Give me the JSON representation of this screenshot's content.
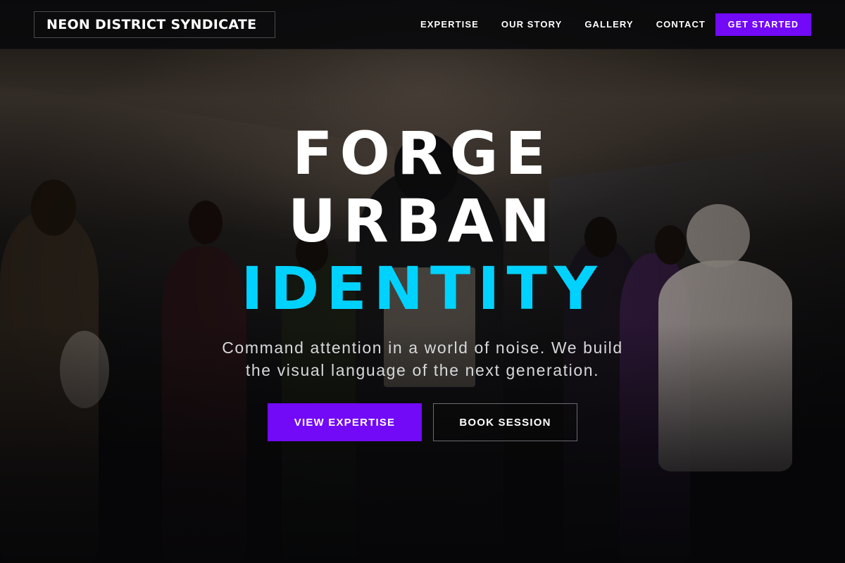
{
  "brand": {
    "name": "NEON DISTRICT SYNDICATE"
  },
  "nav": {
    "links": [
      "EXPERTISE",
      "OUR STORY",
      "GALLERY",
      "CONTACT"
    ],
    "cta_label": "GET STARTED"
  },
  "hero": {
    "headline_line1": "FORGE",
    "headline_line2": "URBAN",
    "headline_line3": "IDENTITY",
    "subtext_line1": "Command attention in a world of noise. We build",
    "subtext_line2": "the visual language of the next generation.",
    "primary_button": "VIEW EXPERTISE",
    "secondary_button": "BOOK SESSION",
    "background_image": "fashion-crowd-photo"
  },
  "colors": {
    "accent_purple": "#7209f7",
    "accent_cyan": "#00d2ff",
    "nav_bg": "#0a0a0c",
    "text": "#ffffff"
  }
}
